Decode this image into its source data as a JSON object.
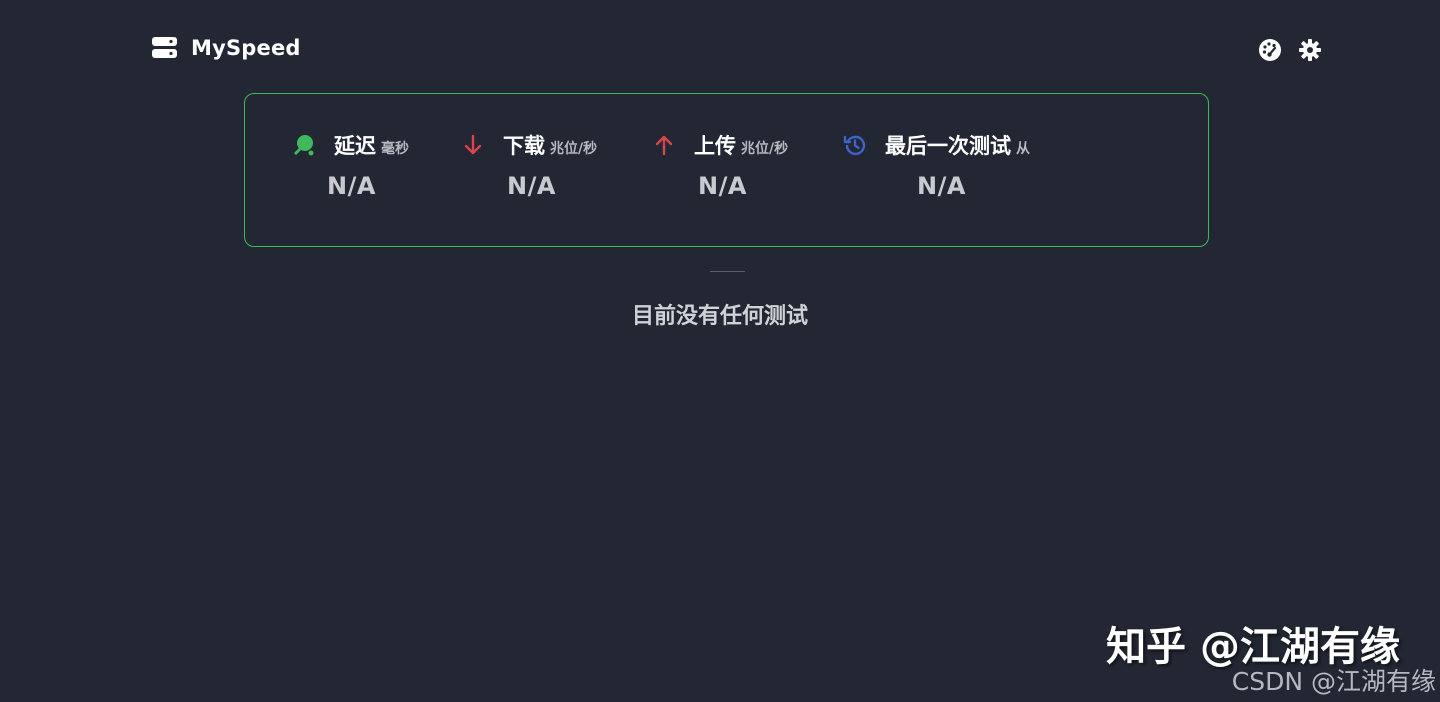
{
  "header": {
    "brand_icon": "server-icon",
    "title": "MySpeed",
    "actions": [
      {
        "icon": "dashboard-palette-icon"
      },
      {
        "icon": "gear-icon"
      }
    ]
  },
  "stats": [
    {
      "icon": "ping-pong-icon",
      "icon_color": "#3fb95b",
      "label": "延迟",
      "unit": "毫秒",
      "value": "N/A"
    },
    {
      "icon": "arrow-down-icon",
      "icon_color": "#d9454a",
      "label": "下载",
      "unit": "兆位/秒",
      "value": "N/A"
    },
    {
      "icon": "arrow-up-icon",
      "icon_color": "#d9454a",
      "label": "上传",
      "unit": "兆位/秒",
      "value": "N/A"
    },
    {
      "icon": "history-icon",
      "icon_color": "#3f63c9",
      "label": "最后一次测试",
      "unit": "从",
      "value": "N/A"
    }
  ],
  "main": {
    "empty_message": "目前没有任何测试"
  },
  "watermarks": {
    "zhihu": "知乎 @江湖有缘",
    "csdn": "CSDN @江湖有缘"
  },
  "colors": {
    "background": "#222733",
    "accent_green": "#3fb95b",
    "accent_red": "#d9454a",
    "accent_blue": "#3f63c9"
  }
}
